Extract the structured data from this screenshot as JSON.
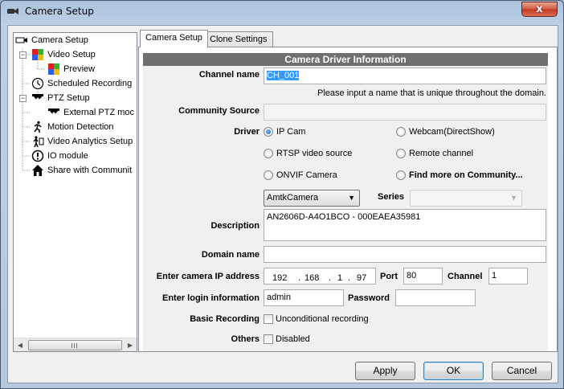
{
  "window": {
    "title": "Camera Setup",
    "close_glyph": "x"
  },
  "tree": {
    "items": [
      {
        "label": "Camera Setup",
        "icon": "camera-icon"
      },
      {
        "label": "Video Setup",
        "icon": "color-grid-icon"
      },
      {
        "label": "Preview",
        "icon": "color-grid-icon"
      },
      {
        "label": "Scheduled Recording",
        "icon": "clock-icon"
      },
      {
        "label": "PTZ Setup",
        "icon": "dome-camera-icon"
      },
      {
        "label": "External PTZ moc",
        "icon": "dome-camera-icon"
      },
      {
        "label": "Motion Detection",
        "icon": "running-man-icon"
      },
      {
        "label": "Video Analytics Setup",
        "icon": "analytics-icon"
      },
      {
        "label": "IO module",
        "icon": "exclamation-icon"
      },
      {
        "label": "Share with Communit",
        "icon": "house-icon"
      }
    ]
  },
  "tabs": [
    {
      "label": "Camera Setup",
      "active": true
    },
    {
      "label": "Clone Settings",
      "active": false
    }
  ],
  "section_title": "Camera Driver Information",
  "form": {
    "channel_name_label": "Channel name",
    "channel_name_value": "CH_001",
    "channel_name_hint": "Please input a name that is unique throughout the domain.",
    "community_source_label": "Community Source",
    "community_source_value": "",
    "driver_label": "Driver",
    "driver_options": [
      {
        "label": "IP Cam",
        "selected": true
      },
      {
        "label": "Webcam(DirectShow)",
        "selected": false
      },
      {
        "label": "RTSP video source",
        "selected": false
      },
      {
        "label": "Remote channel",
        "selected": false
      },
      {
        "label": "ONVIF Camera",
        "selected": false
      },
      {
        "label": "Find more on Community...",
        "selected": false
      }
    ],
    "model_value": "AmtkCamera",
    "series_label": "Series",
    "series_value": "",
    "description_label": "Description",
    "description_value": "AN2606D-A4O1BCO - 000EAEA35981",
    "domain_name_label": "Domain name",
    "domain_name_value": "",
    "ip_label": "Enter camera IP address",
    "ip_octets": [
      "192",
      "168",
      "1",
      "97"
    ],
    "port_label": "Port",
    "port_value": "80",
    "channel_label": "Channel",
    "channel_value": "1",
    "login_label": "Enter login information",
    "login_value": "admin",
    "password_label": "Password",
    "password_value": "",
    "basic_recording_label": "Basic Recording",
    "basic_recording_option": "Unconditional recording",
    "basic_recording_checked": false,
    "others_label": "Others",
    "others_option": "Disabled",
    "others_checked": false
  },
  "buttons": {
    "apply": "Apply",
    "ok": "OK",
    "cancel": "Cancel"
  },
  "colors": {
    "section_header": "#6f6f6f",
    "selection": "#3399ff",
    "close_button": "#c8452c"
  }
}
